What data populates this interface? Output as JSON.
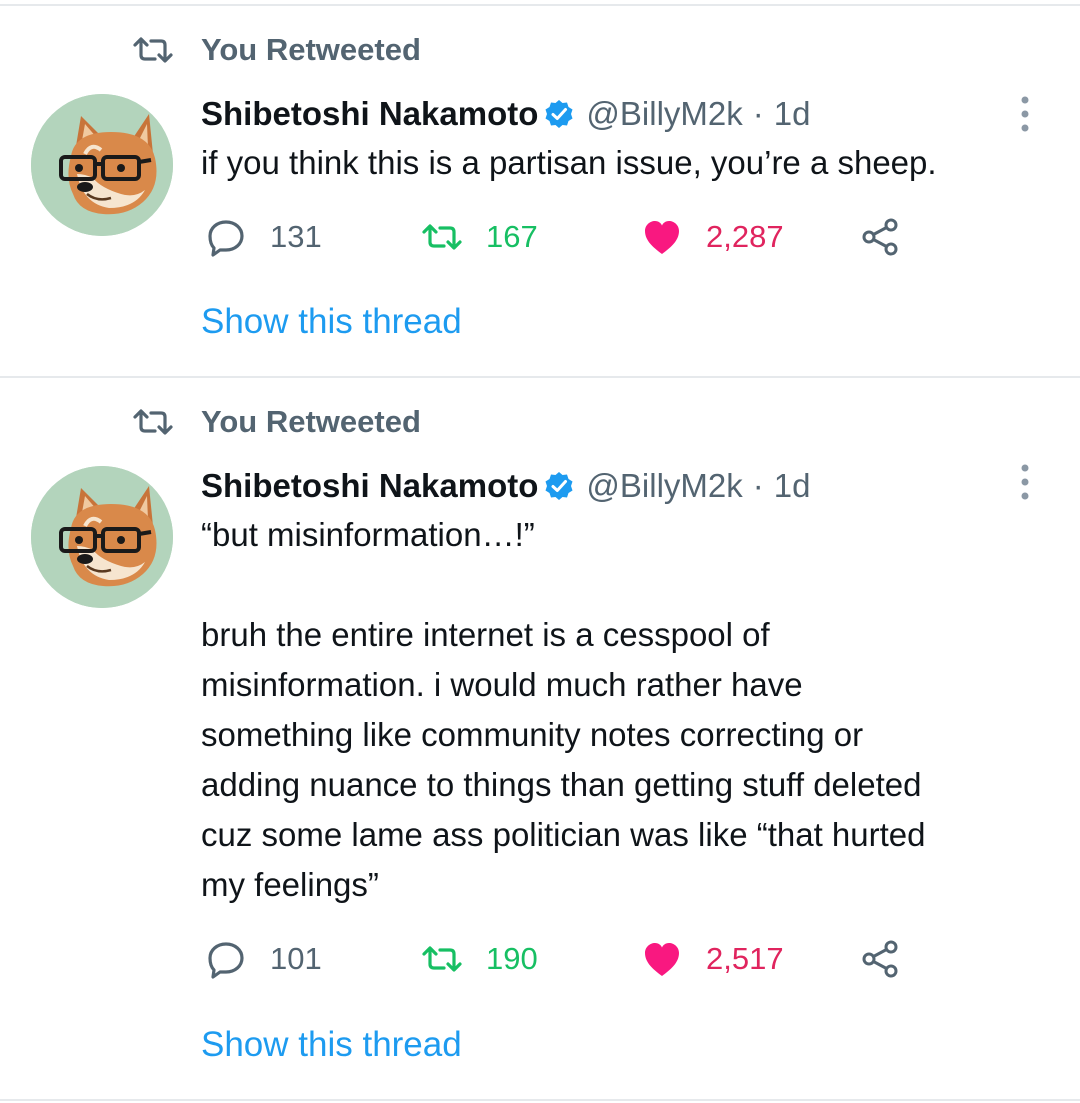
{
  "colors": {
    "retweet_green": "#17bf63",
    "like_pink": "#f91880",
    "link_blue": "#1d9bf0",
    "secondary_gray": "#536471",
    "verified_blue": "#1d9bf0"
  },
  "tweets": [
    {
      "retweet_label": "You Retweeted",
      "author_name": "Shibetoshi Nakamoto",
      "verified": true,
      "handle": "@BillyM2k",
      "separator": "·",
      "time": "1d",
      "text": "if you think this is a partisan issue, you’re a sheep.",
      "replies": "131",
      "retweets": "167",
      "likes": "2,287",
      "show_thread": "Show this thread",
      "icons": [
        "retweet-icon",
        "verified-icon",
        "more-icon",
        "reply-icon",
        "like-icon",
        "share-icon"
      ]
    },
    {
      "retweet_label": "You Retweeted",
      "author_name": "Shibetoshi Nakamoto",
      "verified": true,
      "handle": "@BillyM2k",
      "separator": "·",
      "time": "1d",
      "text": "“but misinformation…!”\n\nbruh the entire internet is a cesspool of\nmisinformation. i would much rather have\nsomething like community notes correcting or\nadding nuance to things than getting stuff deleted\ncuz some lame ass politician was like “that hurted\nmy feelings”",
      "replies": "101",
      "retweets": "190",
      "likes": "2,517",
      "show_thread": "Show this thread",
      "icons": [
        "retweet-icon",
        "verified-icon",
        "more-icon",
        "reply-icon",
        "like-icon",
        "share-icon"
      ]
    }
  ]
}
